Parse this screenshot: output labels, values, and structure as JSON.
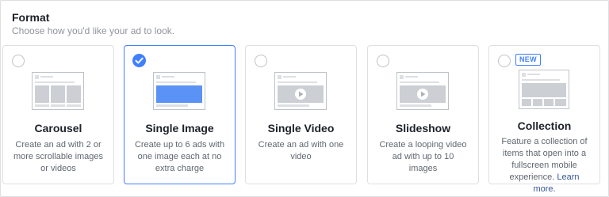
{
  "header": {
    "title": "Format",
    "subtitle": "Choose how you'd like your ad to look."
  },
  "formats": [
    {
      "title": "Carousel",
      "description": "Create an ad with 2 or more scrollable images or videos",
      "selected": false
    },
    {
      "title": "Single Image",
      "description": "Create up to 6 ads with one image each at no extra charge",
      "selected": true
    },
    {
      "title": "Single Video",
      "description": "Create an ad with one video",
      "selected": false
    },
    {
      "title": "Slideshow",
      "description": "Create a looping video ad with up to 10 images",
      "selected": false
    },
    {
      "title": "Collection",
      "description": "Feature a collection of items that open into a fullscreen mobile experience.",
      "badge": "NEW",
      "link_text": "Learn more.",
      "selected": false
    }
  ],
  "colors": {
    "accent": "#4080ff",
    "link": "#365899",
    "muted_text": "#606770"
  }
}
